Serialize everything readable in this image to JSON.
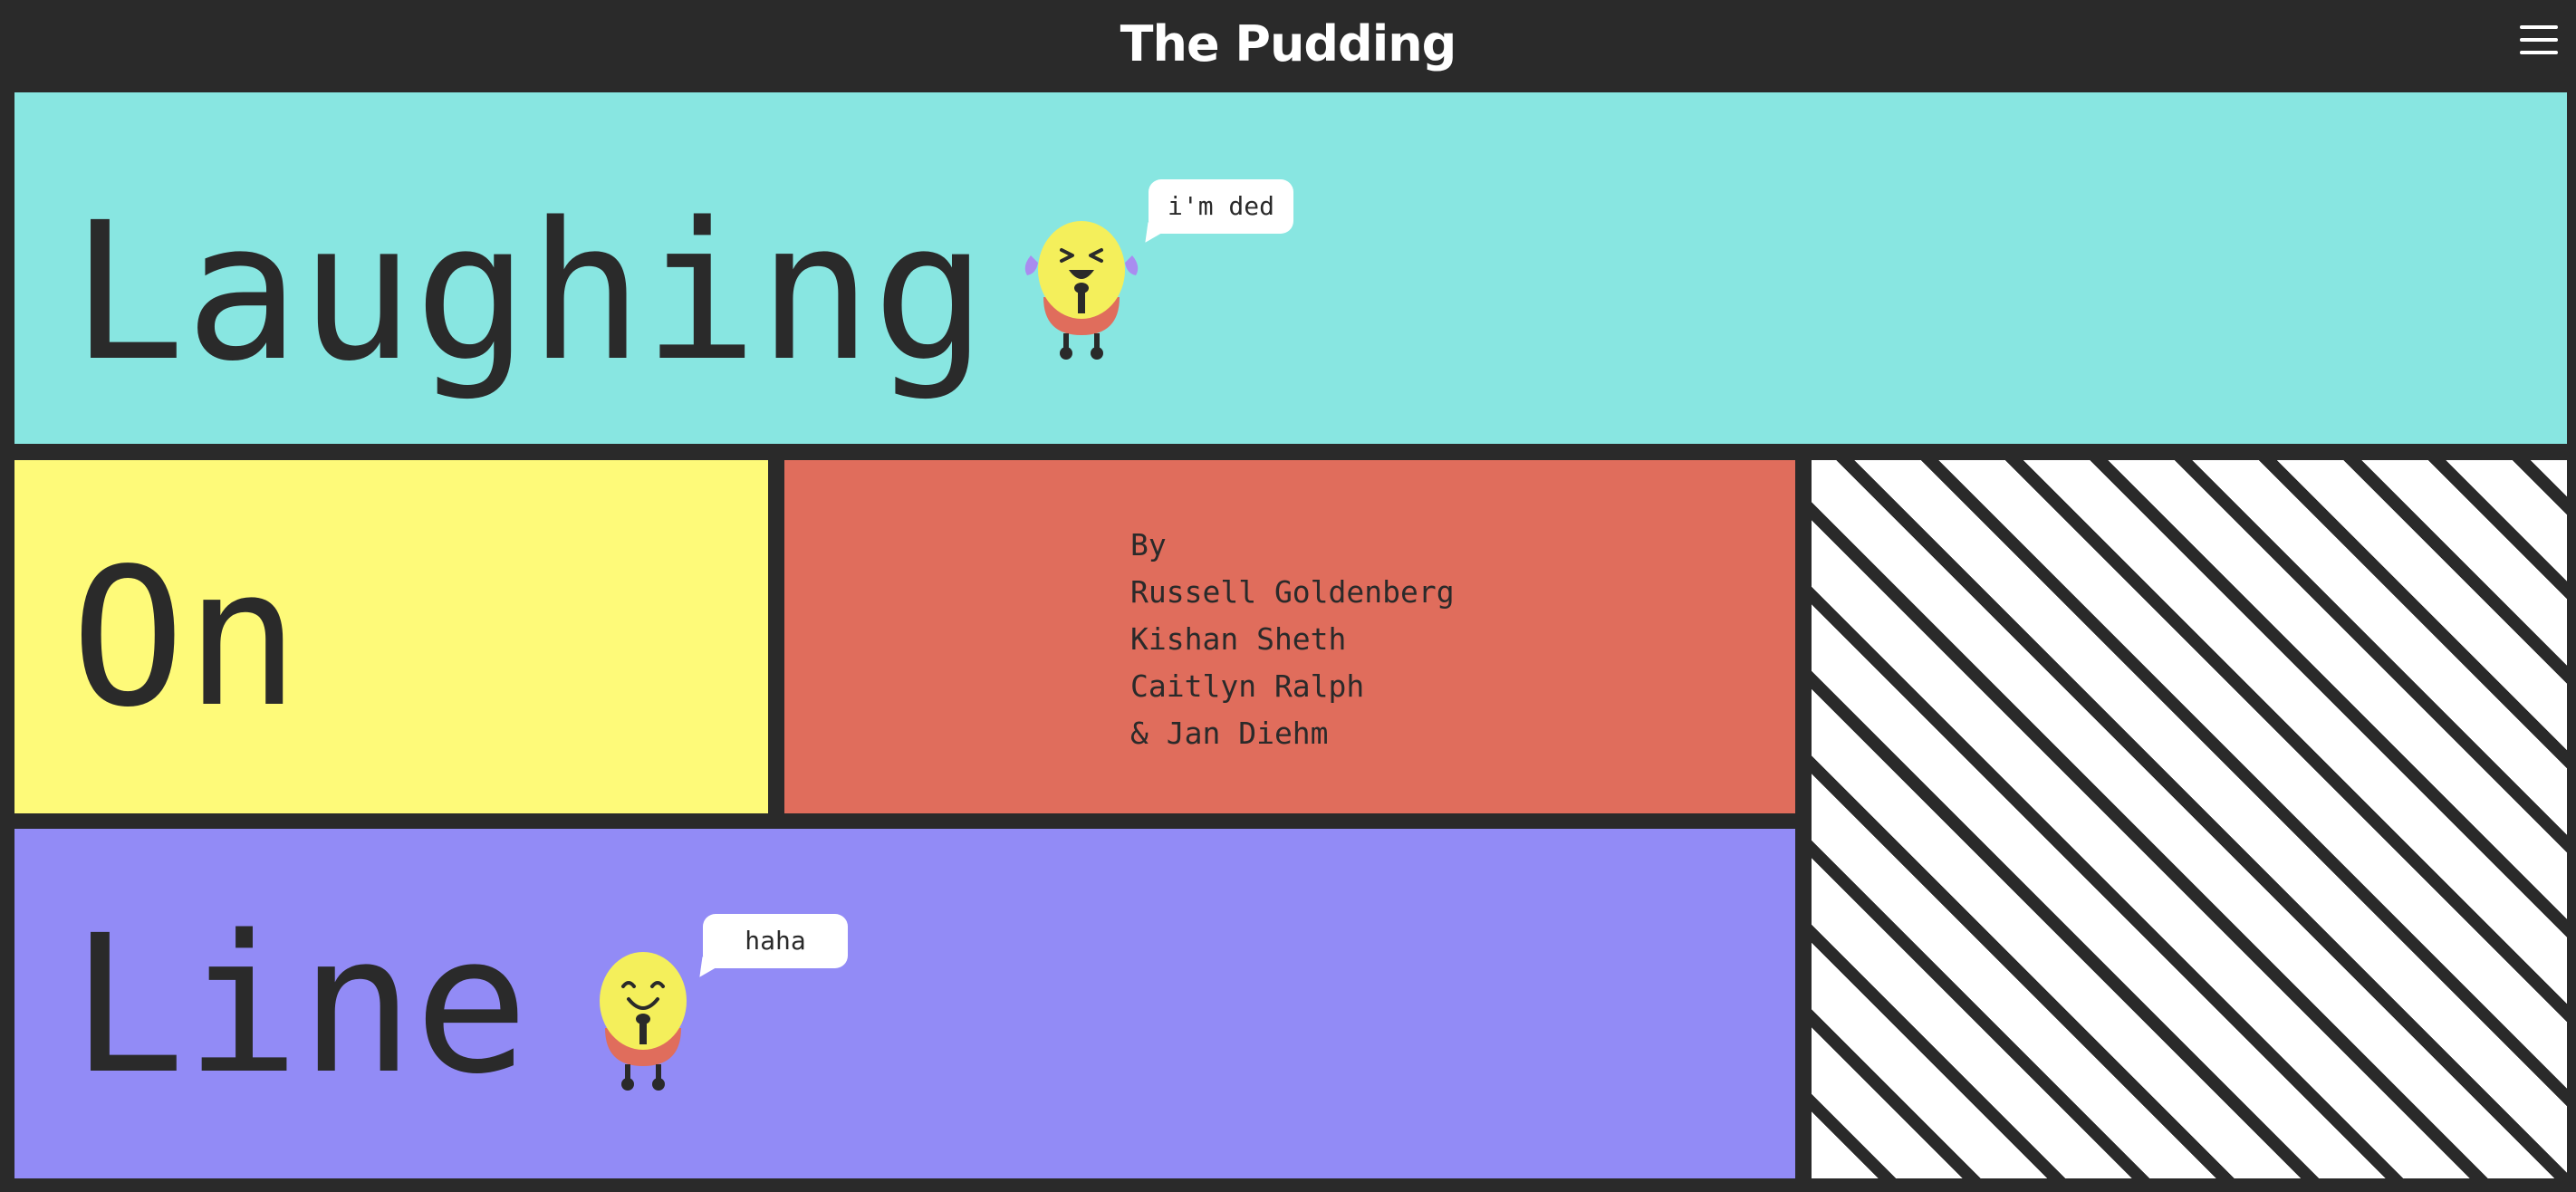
{
  "header": {
    "logo_text": "The Pudding",
    "menu_icon": "hamburger-menu-icon"
  },
  "title": {
    "word_1": "Laughing",
    "word_2": "On",
    "word_3": "Line"
  },
  "byline": {
    "prefix": "By",
    "authors": [
      "Russell Goldenberg",
      "Kishan Sheth",
      "Caitlyn Ralph",
      "& Jan Diehm"
    ]
  },
  "speech_bubbles": {
    "crying_laughing": "i'm ded",
    "happy": "haha"
  },
  "colors": {
    "background": "#2a2a2a",
    "teal": "#88e6e1",
    "yellow": "#fefa79",
    "coral": "#e06d5c",
    "purple": "#928bf6",
    "stripe_white": "#ffffff",
    "character_yellow": "#f4ef5b",
    "character_pants": "#e06d5c"
  }
}
